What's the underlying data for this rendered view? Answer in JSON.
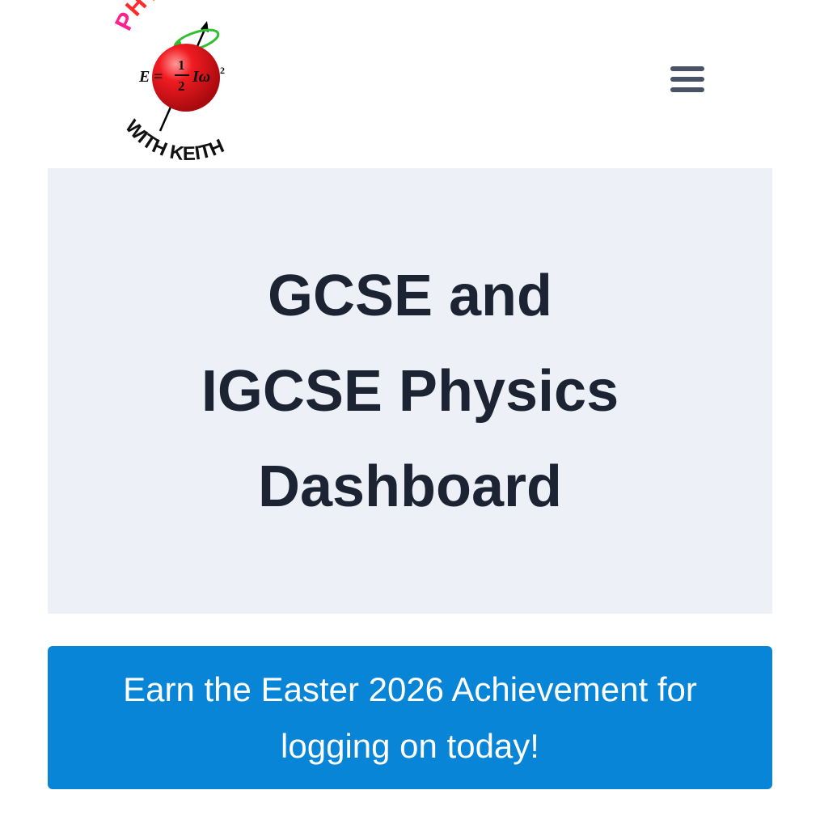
{
  "header": {
    "logo": {
      "word_top": "PHYSICS",
      "word_bottom": "WITH KEITH",
      "formula": "E = ½ Iω²",
      "sphere_color": "#e8121a",
      "orbit_color": "#2fbf2f"
    },
    "menu_icon": "hamburger-menu-icon"
  },
  "hero": {
    "title_line1": "GCSE and",
    "title_line2": "IGCSE Physics",
    "title_line3": "Dashboard"
  },
  "banner": {
    "text": "Earn the Easter 2026 Achievement for logging on today!",
    "background": "#0885d6"
  },
  "colors": {
    "hero_background": "#edf1f7",
    "title_text": "#1c2433",
    "menu_icon": "#4a5366"
  }
}
